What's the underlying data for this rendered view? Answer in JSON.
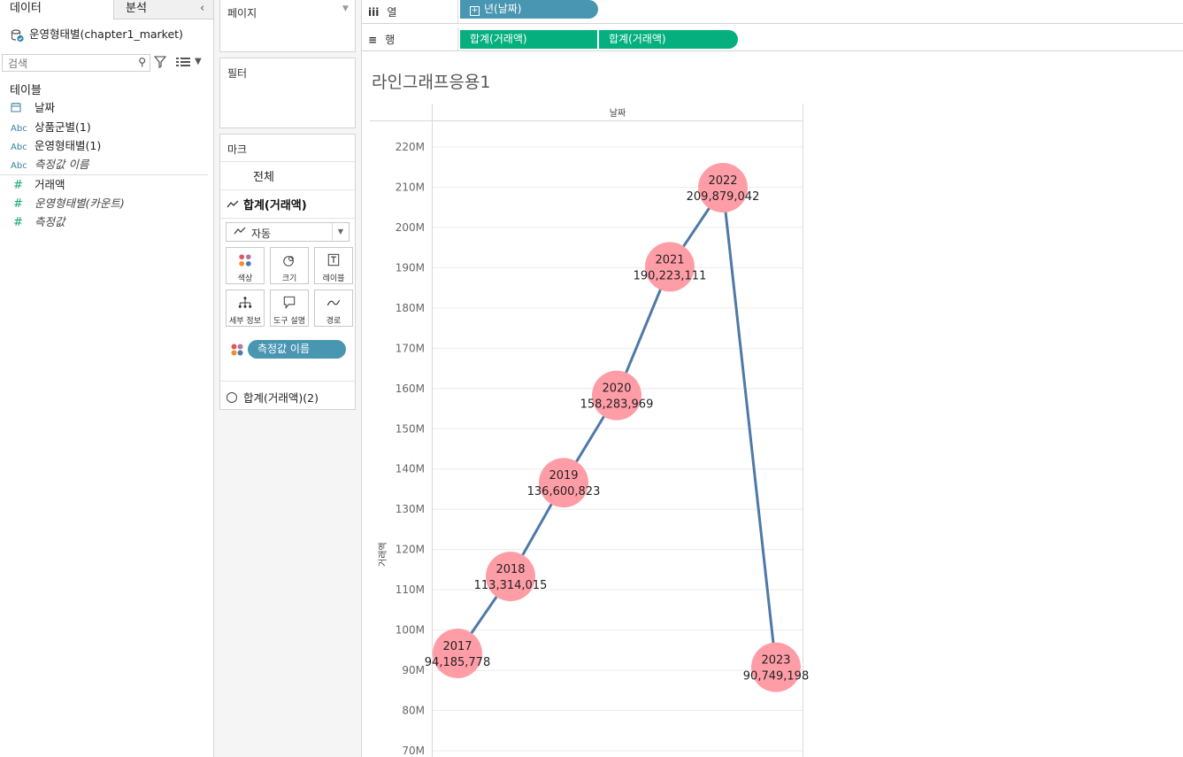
{
  "left_pane": {
    "tabs": {
      "data": "데이터",
      "analysis": "분석"
    },
    "collapse_icon": "<",
    "datasource": "운영형태별(chapter1_market)",
    "search_placeholder": "검색",
    "tables_heading": "테이블",
    "fields": [
      {
        "type_label": "",
        "icon": "calendar-icon",
        "name": "날짜"
      },
      {
        "type_label": "Abc",
        "name": "상품군별(1)"
      },
      {
        "type_label": "Abc",
        "name": "운영형태별(1)"
      },
      {
        "type_label": "Abc",
        "name": "측정값 이름"
      },
      {
        "type_label": "#",
        "name": "거래액"
      },
      {
        "type_label": "#",
        "name": "운영형태별(카운트)"
      },
      {
        "type_label": "#",
        "name": "측정값"
      }
    ]
  },
  "cards": {
    "pages_title": "페이지",
    "filters_title": "필터",
    "marks": {
      "title": "마크",
      "all": "전체",
      "sum_label": "합계(거래액)",
      "mark_type": "자동",
      "buttons": [
        "색상",
        "크기",
        "레이블",
        "세부 정보",
        "도구 설명",
        "경로"
      ],
      "color_pill": "측정값 이름",
      "sum2_label": "합계(거래액)(2)"
    }
  },
  "shelves": {
    "columns_label": "열",
    "rows_label": "행",
    "columns_pill": "년(날짜)",
    "rows_pills": [
      "합계(거래액)",
      "합계(거래액)"
    ]
  },
  "viz": {
    "title": "라인그래프응용1",
    "column_header": "날짜",
    "y_axis_title": "거래액"
  },
  "chart_data": {
    "type": "line",
    "x": [
      "2017",
      "2018",
      "2019",
      "2020",
      "2021",
      "2022",
      "2023"
    ],
    "series": [
      {
        "values": [
          94185778,
          113314015,
          136600823,
          158283969,
          190223111,
          209879042,
          90749198
        ]
      }
    ],
    "point_labels": [
      "94,185,778",
      "113,314,015",
      "136,600,823",
      "158,283,969",
      "190,223,111",
      "209,879,042",
      "90,749,198"
    ],
    "y_ticks": [
      "70M",
      "80M",
      "90M",
      "100M",
      "110M",
      "120M",
      "130M",
      "140M",
      "150M",
      "160M",
      "170M",
      "180M",
      "190M",
      "200M",
      "210M",
      "220M"
    ],
    "ylabel": "거래액",
    "ylim": [
      70000000,
      220000000
    ],
    "colors": {
      "line": "#4e79a7",
      "marker": "#ff9da7",
      "grid": "#ececec"
    }
  }
}
